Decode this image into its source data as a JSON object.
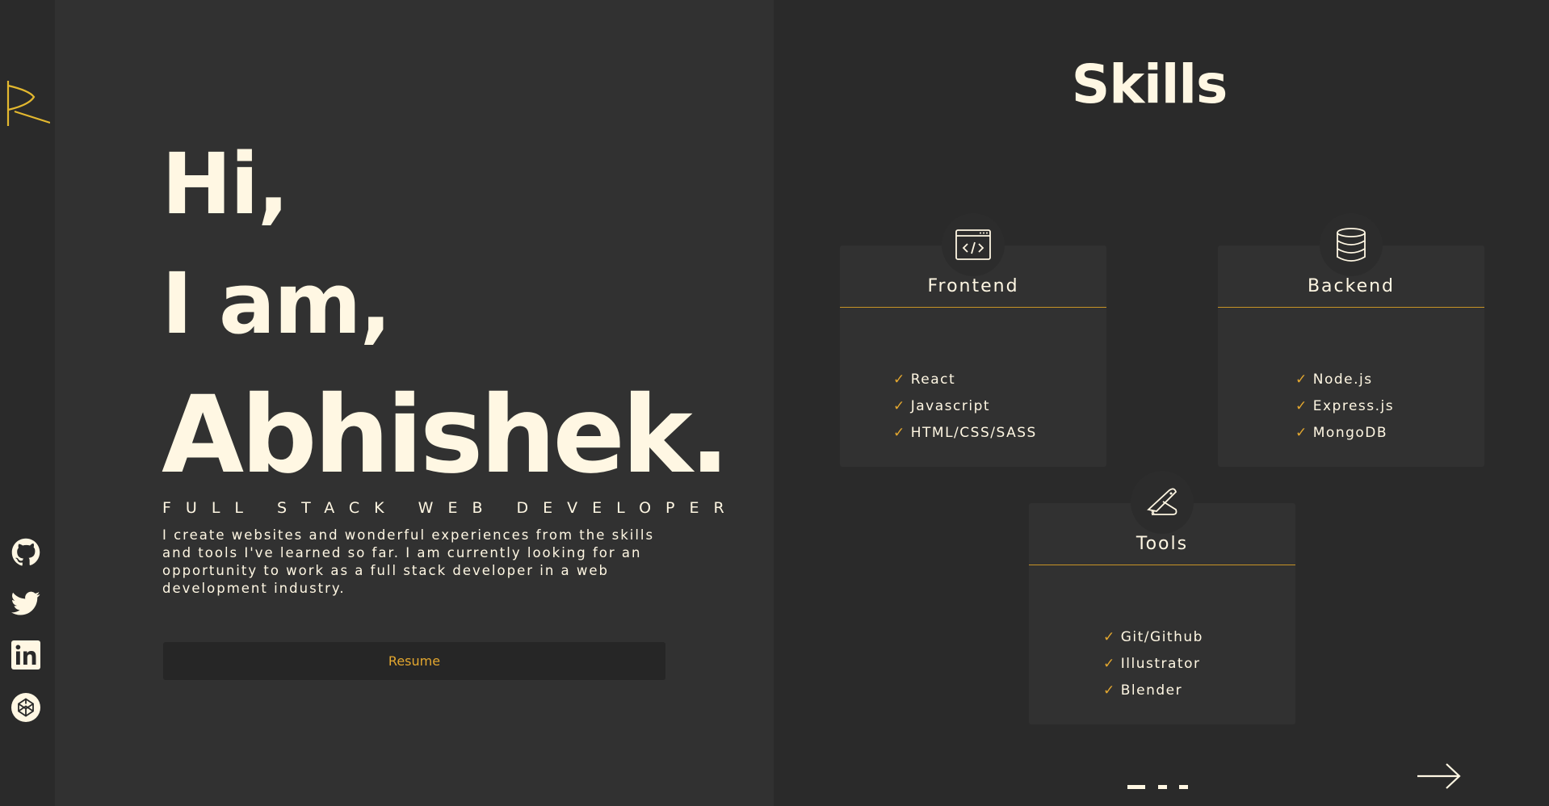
{
  "sidebar": {
    "logo_icon": "monogram-logo-icon",
    "social": [
      {
        "name": "github",
        "icon": "github-icon"
      },
      {
        "name": "twitter",
        "icon": "twitter-icon"
      },
      {
        "name": "linkedin",
        "icon": "linkedin-icon"
      },
      {
        "name": "codepen",
        "icon": "codepen-icon"
      }
    ]
  },
  "hero": {
    "line1": "Hi,",
    "line2": "I am,",
    "line3": "Abhishek.",
    "subtitle": "FULL STACK WEB DEVELOPER",
    "intro": "I create websites and wonderful experiences from the skills and tools I've learned so far. I am currently looking for an opportunity to work as a full stack developer in a web development industry.",
    "resume_label": "Resume"
  },
  "skills": {
    "title": "Skills",
    "cards": [
      {
        "title": "Frontend",
        "icon": "browser-code-icon",
        "items": [
          "React",
          "Javascript",
          "HTML/CSS/SASS"
        ]
      },
      {
        "title": "Backend",
        "icon": "database-icon",
        "items": [
          "Node.js",
          "Express.js",
          "MongoDB"
        ]
      },
      {
        "title": "Tools",
        "icon": "tools-icon",
        "items": [
          "Git/Github",
          "Illustrator",
          "Blender"
        ]
      }
    ],
    "pagination": {
      "current": 1,
      "total": 3
    },
    "next_icon": "arrow-right-icon"
  },
  "colors": {
    "accent": "#e3a72f",
    "text": "#fff7e3",
    "panel_left": "#313131",
    "background": "#2a2a2a"
  }
}
